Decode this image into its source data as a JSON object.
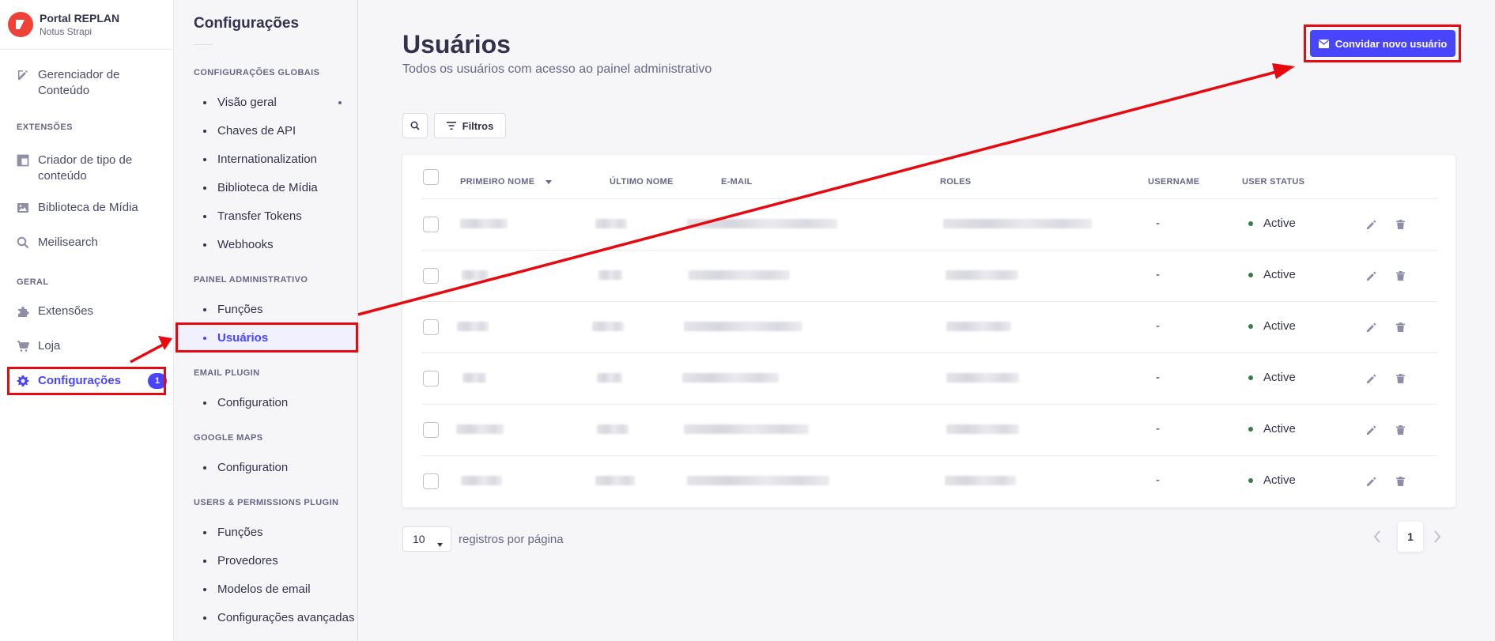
{
  "brand": {
    "title": "Portal REPLAN",
    "subtitle": "Notus Strapi"
  },
  "mainnav": {
    "content_manager": "Gerenciador de Conteúdo",
    "section_extensions": "EXTENSÕES",
    "content_type_builder": "Criador de tipo de conteúdo",
    "media_library": "Biblioteca de Mídia",
    "meilisearch": "Meilisearch",
    "section_general": "GERAL",
    "plugins": "Extensões",
    "marketplace": "Loja",
    "settings": "Configurações",
    "settings_badge": "1"
  },
  "subnav": {
    "title": "Configurações",
    "global_section": "CONFIGURAÇÕES GLOBAIS",
    "global_items": [
      "Visão geral",
      "Chaves de API",
      "Internationalization",
      "Biblioteca de Mídia",
      "Transfer Tokens",
      "Webhooks"
    ],
    "admin_section": "PAINEL ADMINISTRATIVO",
    "admin_items": [
      "Funções",
      "Usuários"
    ],
    "email_section": "EMAIL PLUGIN",
    "email_items": [
      "Configuration"
    ],
    "maps_section": "GOOGLE MAPS",
    "maps_items": [
      "Configuration"
    ],
    "up_section": "USERS & PERMISSIONS PLUGIN",
    "up_items": [
      "Funções",
      "Provedores",
      "Modelos de email",
      "Configurações avançadas"
    ]
  },
  "page": {
    "title": "Usuários",
    "subtitle": "Todos os usuários com acesso ao painel administrativo",
    "invite_label": "Convidar novo usuário",
    "filters_label": "Filtros"
  },
  "table": {
    "headers": [
      "PRIMEIRO NOME",
      "ÚLTIMO NOME",
      "E-MAIL",
      "ROLES",
      "USERNAME",
      "USER STATUS"
    ],
    "rows": [
      {
        "username": "-",
        "status": "Active"
      },
      {
        "username": "-",
        "status": "Active"
      },
      {
        "username": "-",
        "status": "Active"
      },
      {
        "username": "-",
        "status": "Active"
      },
      {
        "username": "-",
        "status": "Active"
      },
      {
        "username": "-",
        "status": "Active"
      }
    ]
  },
  "pagination": {
    "per_page": "10",
    "per_page_label": "registros por página",
    "current_page": "1"
  },
  "colors": {
    "primary": "#4945ff",
    "status_active": "#328048",
    "annotation": "#e8090e",
    "logo": "#ef4135"
  }
}
